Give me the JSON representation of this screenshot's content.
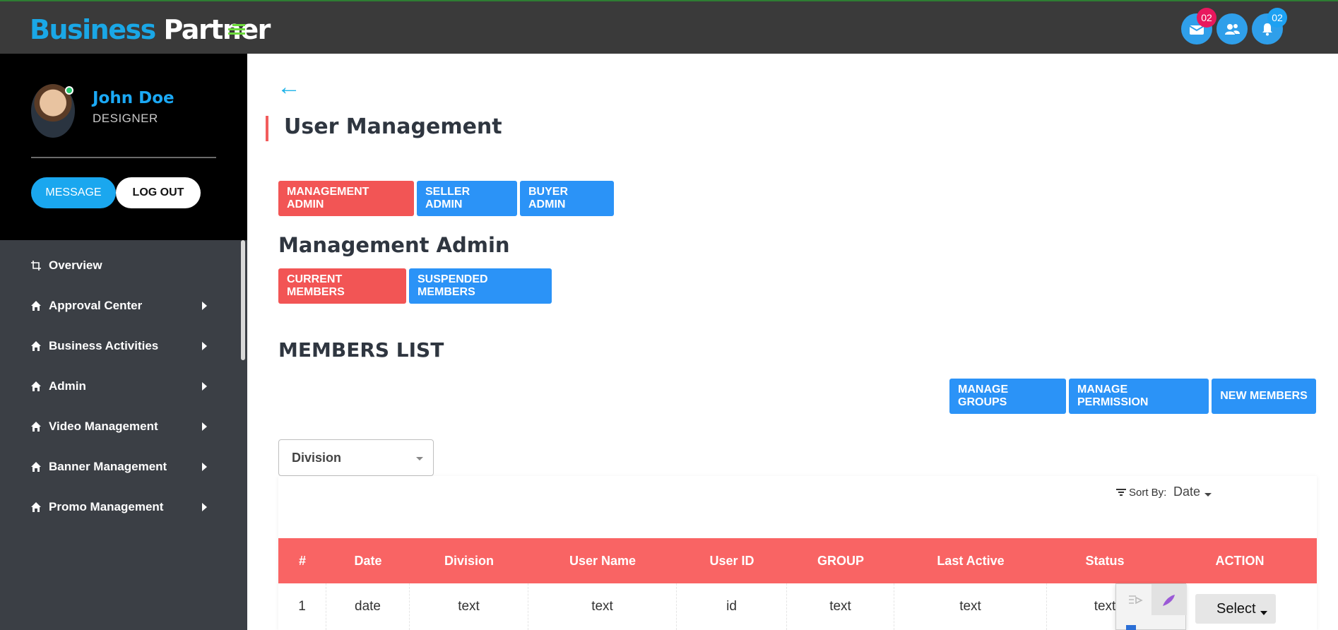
{
  "header": {
    "logo_part1": "Business",
    "logo_part2": "Partner",
    "mail_badge": "02",
    "notify_badge": "02",
    "colors": {
      "mail_badge": "#e8175d",
      "notify_badge": "#1da1f2"
    }
  },
  "profile": {
    "name": "John Doe",
    "role": "DESIGNER",
    "message_label": "MESSAGE",
    "logout_label": "LOG OUT"
  },
  "sidebar": {
    "items": [
      {
        "label": "Overview",
        "icon": "crop-icon"
      },
      {
        "label": "Approval Center",
        "icon": "home-icon"
      },
      {
        "label": "Business Activities",
        "icon": "home-icon"
      },
      {
        "label": "Admin",
        "icon": "home-icon"
      },
      {
        "label": "Video Management",
        "icon": "home-icon"
      },
      {
        "label": "Banner Management",
        "icon": "home-icon"
      },
      {
        "label": "Promo Management",
        "icon": "home-icon"
      }
    ]
  },
  "main": {
    "title": "User Management",
    "admin_tabs": [
      "MANAGEMENT ADMIN",
      "SELLER ADMIN",
      "BUYER ADMIN"
    ],
    "section_title": "Management Admin",
    "member_tabs": [
      "CURRENT MEMBERS",
      "SUSPENDED MEMBERS"
    ],
    "list_title": "MEMBERS LIST",
    "actions": [
      "MANAGE GROUPS",
      "MANAGE PERMISSION",
      "NEW MEMBERS"
    ],
    "division_select": "Division",
    "sort_label": "Sort By:",
    "sort_value": "Date"
  },
  "table": {
    "headers": [
      "#",
      "Date",
      "Division",
      "User Name",
      "User ID",
      "GROUP",
      "Last Active",
      "Status",
      "ACTION"
    ],
    "rows": [
      [
        "1",
        "date",
        "text",
        "text",
        "id",
        "text",
        "text",
        "text"
      ]
    ],
    "action_select": "Select"
  },
  "colors": {
    "accent_red": "#f25555",
    "accent_blue": "#2b93f7",
    "header_bg": "#3a3a3a",
    "sidebar_bg": "#3b3f45"
  }
}
